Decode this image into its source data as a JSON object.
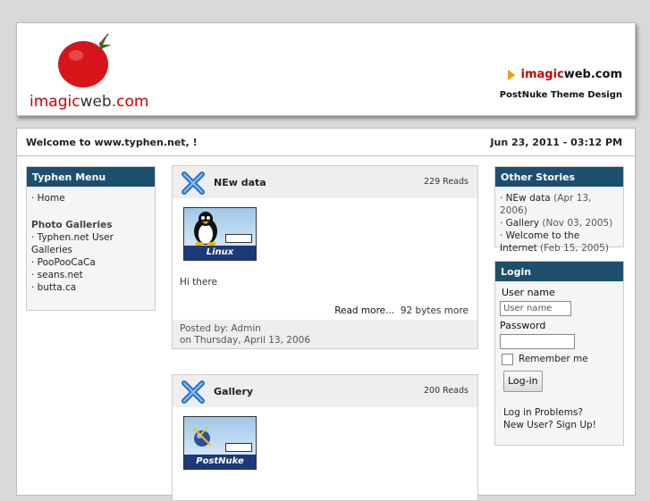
{
  "header": {
    "logo_part1": "imagic",
    "logo_part2": "web",
    "logo_part3": ".com",
    "brand_red": "imagic",
    "brand_black": "web.com",
    "tagline": "PostNuke Theme Design"
  },
  "welcome": "Welcome to www.typhen.net, !",
  "date": "Jun 23, 2011 - 03:12 PM",
  "menu": {
    "title": "Typhen Menu",
    "home": "· Home",
    "group": "Photo Galleries",
    "items": [
      "· Typhen.net User Galleries",
      "· PooPooCaCa",
      "· seans.net",
      "· butta.ca"
    ]
  },
  "articles": [
    {
      "title": "NEw data",
      "reads": "229 Reads",
      "topic": "Linux",
      "text": "Hi there",
      "readmore": "Read more...",
      "size": "92 bytes more",
      "posted_by": "Posted by: Admin",
      "posted_on": "on Thursday, April 13, 2006"
    },
    {
      "title": "Gallery",
      "reads": "200 Reads",
      "topic": "PostNuke"
    }
  ],
  "other_stories": {
    "title": "Other Stories",
    "items": [
      {
        "name": "· NEw data",
        "date": "(Apr 13, 2006)"
      },
      {
        "name": "· Gallery",
        "date": "(Nov 03, 2005)"
      },
      {
        "name": "· Welcome to the Internet",
        "date": "(Feb 15, 2005)"
      }
    ]
  },
  "login": {
    "title": "Login",
    "username_label": "User name",
    "username_placeholder": "User name",
    "password_label": "Password",
    "remember": "Remember me",
    "button": "Log-in",
    "problems": "Log in Problems?",
    "signup": "New User? Sign Up!"
  },
  "colors": {
    "box_header": "#1e4f6e",
    "logo_red": "#cc0000",
    "arrow": "#f0a000"
  }
}
